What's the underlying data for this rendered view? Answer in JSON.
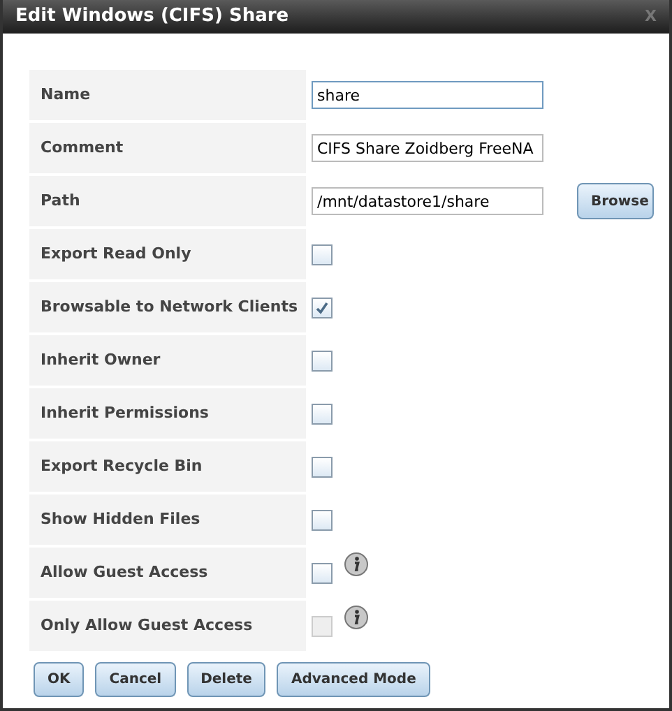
{
  "window": {
    "title": "Edit Windows (CIFS) Share",
    "close": "X"
  },
  "fields": [
    {
      "kind": "text",
      "label": "Name",
      "value": "share",
      "focused": true
    },
    {
      "kind": "text",
      "label": "Comment",
      "value": "CIFS Share Zoidberg FreeNA",
      "focused": false
    },
    {
      "kind": "text",
      "label": "Path",
      "value": "/mnt/datastore1/share",
      "focused": false,
      "button": "Browse"
    },
    {
      "kind": "checkbox",
      "label": "Export Read Only",
      "checked": false,
      "disabled": false,
      "info": false
    },
    {
      "kind": "checkbox",
      "label": "Browsable to Network Clients",
      "checked": true,
      "disabled": false,
      "info": false
    },
    {
      "kind": "checkbox",
      "label": "Inherit Owner",
      "checked": false,
      "disabled": false,
      "info": false
    },
    {
      "kind": "checkbox",
      "label": "Inherit Permissions",
      "checked": false,
      "disabled": false,
      "info": false
    },
    {
      "kind": "checkbox",
      "label": "Export Recycle Bin",
      "checked": false,
      "disabled": false,
      "info": false
    },
    {
      "kind": "checkbox",
      "label": "Show Hidden Files",
      "checked": false,
      "disabled": false,
      "info": false
    },
    {
      "kind": "checkbox",
      "label": "Allow Guest Access",
      "checked": false,
      "disabled": false,
      "info": true
    },
    {
      "kind": "checkbox",
      "label": "Only Allow Guest Access",
      "checked": false,
      "disabled": true,
      "info": true
    }
  ],
  "buttons": [
    "OK",
    "Cancel",
    "Delete",
    "Advanced Mode"
  ]
}
